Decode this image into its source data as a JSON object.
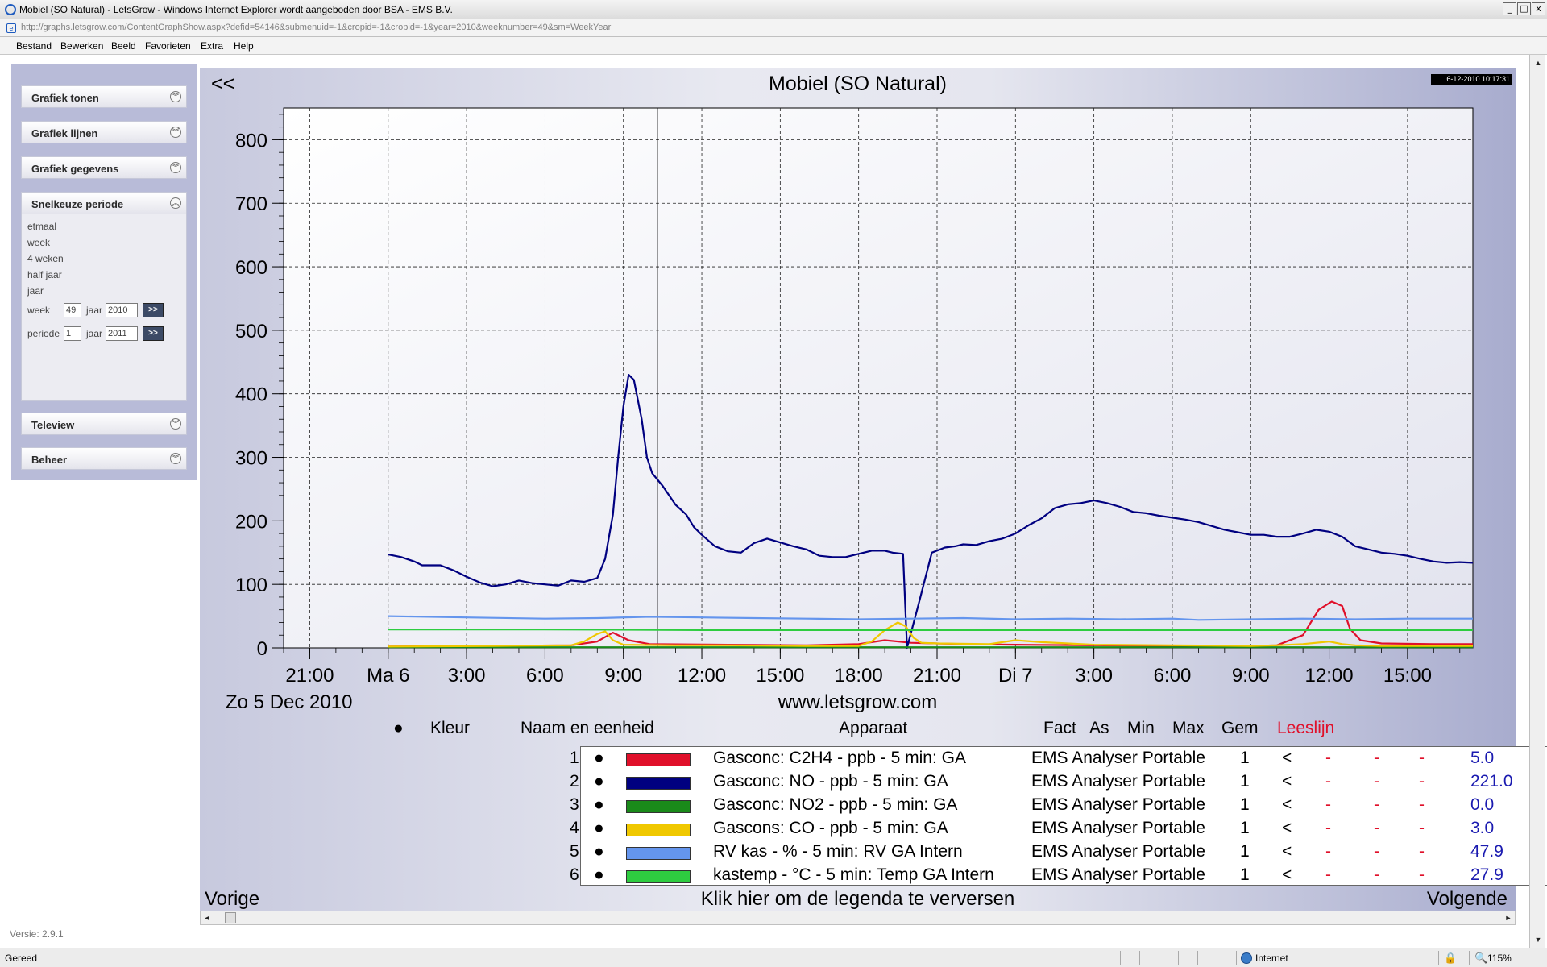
{
  "window": {
    "title": "Mobiel (SO Natural) - LetsGrow - Windows Internet Explorer wordt aangeboden door BSA - EMS B.V.",
    "url": "http://graphs.letsgrow.com/ContentGraphShow.aspx?defid=54146&submenuid=-1&cropid=-1&cropid=-1&year=2010&weeknumber=49&sm=WeekYear",
    "minimize": "_",
    "maximize": "□",
    "close": "x"
  },
  "menu": [
    "Bestand",
    "Bewerken",
    "Beeld",
    "Favorieten",
    "Extra",
    "Help"
  ],
  "sidebar": {
    "panels": [
      {
        "label": "Grafiek tonen"
      },
      {
        "label": "Grafiek lijnen"
      },
      {
        "label": "Grafiek gegevens"
      },
      {
        "label": "Snelkeuze periode"
      },
      {
        "label": "Teleview"
      },
      {
        "label": "Beheer"
      }
    ],
    "snelkeuze": {
      "links": [
        "etmaal",
        "week",
        "4 weken",
        "half jaar",
        "jaar"
      ],
      "week_label": "week",
      "week_value": "49",
      "jaar_label": "jaar",
      "jaar_value": "2010",
      "periode_label": "periode",
      "periode_value": "1",
      "jaar2_value": "2011",
      "go_label": ">>"
    },
    "version": "Versie: 2.9.1"
  },
  "chart_header": {
    "title": "Mobiel (SO Natural)",
    "back": "<<",
    "timestamp": "6-12-2010 10:17:31",
    "start_date": "Zo  5  Dec 2010",
    "website": "www.letsgrow.com"
  },
  "chart_data": {
    "type": "line",
    "title": "Mobiel (SO Natural)",
    "ylim": [
      0,
      850
    ],
    "yticks": [
      0,
      100,
      200,
      300,
      400,
      500,
      600,
      700,
      800
    ],
    "x_unit": "hours from Sun 5 Dec 2010 18:00",
    "xlim": [
      0,
      45.5
    ],
    "xticks": [
      {
        "x": 1,
        "label": "21:00"
      },
      {
        "x": 4,
        "label": "Ma  6"
      },
      {
        "x": 7,
        "label": "3:00"
      },
      {
        "x": 10,
        "label": "6:00"
      },
      {
        "x": 13,
        "label": "9:00"
      },
      {
        "x": 16,
        "label": "12:00"
      },
      {
        "x": 19,
        "label": "15:00"
      },
      {
        "x": 22,
        "label": "18:00"
      },
      {
        "x": 25,
        "label": "21:00"
      },
      {
        "x": 28,
        "label": "Di  7"
      },
      {
        "x": 31,
        "label": "3:00"
      },
      {
        "x": 34,
        "label": "6:00"
      },
      {
        "x": 37,
        "label": "9:00"
      },
      {
        "x": 40,
        "label": "12:00"
      },
      {
        "x": 43,
        "label": "15:00"
      }
    ],
    "read_line_x": 14.3,
    "grid": true,
    "series": [
      {
        "name": "Gasconc: C2H4 - ppb - 5 min: GA",
        "color": "#e0102a",
        "points": [
          [
            4,
            2
          ],
          [
            8,
            3
          ],
          [
            11,
            4
          ],
          [
            12,
            10
          ],
          [
            12.6,
            24
          ],
          [
            13.2,
            12
          ],
          [
            14,
            6
          ],
          [
            17,
            5
          ],
          [
            20,
            4
          ],
          [
            22,
            6
          ],
          [
            23,
            12
          ],
          [
            24,
            8
          ],
          [
            26,
            6
          ],
          [
            28,
            5
          ],
          [
            31,
            4
          ],
          [
            34,
            3
          ],
          [
            37,
            3
          ],
          [
            38,
            4
          ],
          [
            39,
            20
          ],
          [
            39.6,
            60
          ],
          [
            40.1,
            73
          ],
          [
            40.5,
            66
          ],
          [
            40.8,
            30
          ],
          [
            41.2,
            12
          ],
          [
            42,
            7
          ],
          [
            44,
            6
          ],
          [
            45.5,
            6
          ]
        ]
      },
      {
        "name": "Gasconc: NO - ppb - 5 min: GA",
        "color": "#000080",
        "points": [
          [
            4,
            147
          ],
          [
            4.5,
            143
          ],
          [
            5,
            136
          ],
          [
            5.3,
            130
          ],
          [
            6,
            130
          ],
          [
            6.5,
            122
          ],
          [
            7,
            112
          ],
          [
            7.5,
            103
          ],
          [
            8,
            97
          ],
          [
            8.5,
            100
          ],
          [
            9,
            106
          ],
          [
            9.5,
            102
          ],
          [
            10,
            100
          ],
          [
            10.5,
            98
          ],
          [
            11,
            106
          ],
          [
            11.5,
            104
          ],
          [
            12,
            110
          ],
          [
            12.3,
            140
          ],
          [
            12.6,
            210
          ],
          [
            12.8,
            300
          ],
          [
            13,
            380
          ],
          [
            13.2,
            430
          ],
          [
            13.4,
            422
          ],
          [
            13.7,
            360
          ],
          [
            13.9,
            300
          ],
          [
            14.1,
            275
          ],
          [
            14.5,
            255
          ],
          [
            15,
            225
          ],
          [
            15.4,
            210
          ],
          [
            15.7,
            190
          ],
          [
            16,
            178
          ],
          [
            16.5,
            160
          ],
          [
            17,
            152
          ],
          [
            17.5,
            150
          ],
          [
            18,
            165
          ],
          [
            18.5,
            172
          ],
          [
            19,
            166
          ],
          [
            19.5,
            160
          ],
          [
            20,
            155
          ],
          [
            20.5,
            145
          ],
          [
            21,
            143
          ],
          [
            21.5,
            143
          ],
          [
            22,
            148
          ],
          [
            22.5,
            153
          ],
          [
            23,
            153
          ],
          [
            23.3,
            150
          ],
          [
            23.7,
            148
          ],
          [
            23.85,
            0
          ],
          [
            24.3,
            70
          ],
          [
            24.8,
            150
          ],
          [
            25.3,
            158
          ],
          [
            25.7,
            160
          ],
          [
            26,
            163
          ],
          [
            26.5,
            162
          ],
          [
            27,
            168
          ],
          [
            27.5,
            172
          ],
          [
            28,
            180
          ],
          [
            28.5,
            193
          ],
          [
            29,
            204
          ],
          [
            29.5,
            220
          ],
          [
            30,
            226
          ],
          [
            30.5,
            228
          ],
          [
            31,
            232
          ],
          [
            31.5,
            228
          ],
          [
            32,
            222
          ],
          [
            32.5,
            214
          ],
          [
            33,
            212
          ],
          [
            33.5,
            208
          ],
          [
            34,
            205
          ],
          [
            34.5,
            202
          ],
          [
            35,
            198
          ],
          [
            35.5,
            192
          ],
          [
            36,
            186
          ],
          [
            36.5,
            182
          ],
          [
            37,
            178
          ],
          [
            37.5,
            178
          ],
          [
            38,
            175
          ],
          [
            38.5,
            175
          ],
          [
            39,
            180
          ],
          [
            39.5,
            186
          ],
          [
            40,
            183
          ],
          [
            40.5,
            175
          ],
          [
            41,
            160
          ],
          [
            41.5,
            155
          ],
          [
            42,
            150
          ],
          [
            42.5,
            148
          ],
          [
            43,
            145
          ],
          [
            43.5,
            140
          ],
          [
            44,
            136
          ],
          [
            44.5,
            134
          ],
          [
            45,
            135
          ],
          [
            45.5,
            134
          ]
        ]
      },
      {
        "name": "Gasconc: NO2 - ppb - 5 min: GA",
        "color": "#1a8a1a",
        "points": [
          [
            4,
            1
          ],
          [
            45.5,
            1
          ]
        ]
      },
      {
        "name": "Gascons: CO - ppb - 5 min: GA",
        "color": "#f0c800",
        "points": [
          [
            4,
            2
          ],
          [
            8,
            3
          ],
          [
            11,
            4
          ],
          [
            11.5,
            10
          ],
          [
            12,
            22
          ],
          [
            12.3,
            26
          ],
          [
            12.6,
            12
          ],
          [
            13,
            5
          ],
          [
            15,
            4
          ],
          [
            17,
            4
          ],
          [
            20,
            3
          ],
          [
            22,
            3
          ],
          [
            22.5,
            10
          ],
          [
            23,
            28
          ],
          [
            23.5,
            40
          ],
          [
            23.8,
            34
          ],
          [
            24.1,
            16
          ],
          [
            24.4,
            8
          ],
          [
            25,
            7
          ],
          [
            27,
            6
          ],
          [
            28,
            12
          ],
          [
            29,
            9
          ],
          [
            30,
            7
          ],
          [
            31,
            5
          ],
          [
            34,
            4
          ],
          [
            37,
            3
          ],
          [
            38,
            4
          ],
          [
            39,
            6
          ],
          [
            40,
            10
          ],
          [
            40.5,
            6
          ],
          [
            41,
            4
          ],
          [
            42,
            3
          ],
          [
            45.5,
            3
          ]
        ]
      },
      {
        "name": "RV kas - % - 5 min: RV GA Intern",
        "color": "#6495ed",
        "points": [
          [
            4,
            50
          ],
          [
            7,
            48
          ],
          [
            10,
            46
          ],
          [
            12,
            47
          ],
          [
            14,
            49
          ],
          [
            16,
            48
          ],
          [
            18,
            47
          ],
          [
            20,
            46
          ],
          [
            22,
            45
          ],
          [
            24,
            46
          ],
          [
            26,
            47
          ],
          [
            28,
            45
          ],
          [
            30,
            46
          ],
          [
            32,
            45
          ],
          [
            34,
            46
          ],
          [
            35,
            44
          ],
          [
            37,
            45
          ],
          [
            39,
            46
          ],
          [
            41,
            45
          ],
          [
            43,
            46
          ],
          [
            45.5,
            46
          ]
        ]
      },
      {
        "name": "kastemp - °C - 5 min: Temp GA Intern",
        "color": "#2ecc40",
        "points": [
          [
            4,
            29
          ],
          [
            10,
            29
          ],
          [
            16,
            28
          ],
          [
            22,
            28
          ],
          [
            28,
            28
          ],
          [
            34,
            28
          ],
          [
            40,
            28
          ],
          [
            45.5,
            28
          ]
        ]
      }
    ]
  },
  "legend": {
    "headers": {
      "bullet": "●",
      "kleur": "Kleur",
      "naam": "Naam en eenheid",
      "apparaat": "Apparaat",
      "fact": "Fact",
      "as": "As",
      "min": "Min",
      "max": "Max",
      "gem": "Gem",
      "leeslijn": "Leeslijn"
    },
    "rows": [
      {
        "num": "1",
        "bullet": "●",
        "color": "#e0102a",
        "name": "Gasconc: C2H4 - ppb - 5 min: GA",
        "apparaat": "EMS Analyser Portable",
        "fact": "1",
        "as": "<",
        "min": "-",
        "max": "-",
        "gem": "-",
        "leeslijn": "5.0"
      },
      {
        "num": "2",
        "bullet": "●",
        "color": "#000080",
        "name": "Gasconc: NO - ppb - 5 min: GA",
        "apparaat": "EMS Analyser Portable",
        "fact": "1",
        "as": "<",
        "min": "-",
        "max": "-",
        "gem": "-",
        "leeslijn": "221.0"
      },
      {
        "num": "3",
        "bullet": "●",
        "color": "#1a8a1a",
        "name": "Gasconc: NO2 - ppb - 5 min: GA",
        "apparaat": "EMS Analyser Portable",
        "fact": "1",
        "as": "<",
        "min": "-",
        "max": "-",
        "gem": "-",
        "leeslijn": "0.0"
      },
      {
        "num": "4",
        "bullet": "●",
        "color": "#f0c800",
        "name": "Gascons: CO - ppb - 5 min: GA",
        "apparaat": "EMS Analyser Portable",
        "fact": "1",
        "as": "<",
        "min": "-",
        "max": "-",
        "gem": "-",
        "leeslijn": "3.0"
      },
      {
        "num": "5",
        "bullet": "●",
        "color": "#6495ed",
        "name": "RV kas - % - 5 min: RV GA Intern",
        "apparaat": "EMS Analyser Portable",
        "fact": "1",
        "as": "<",
        "min": "-",
        "max": "-",
        "gem": "-",
        "leeslijn": "47.9"
      },
      {
        "num": "6",
        "bullet": "●",
        "color": "#2ecc40",
        "name": "kastemp - °C - 5 min: Temp GA Intern",
        "apparaat": "EMS Analyser Portable",
        "fact": "1",
        "as": "<",
        "min": "-",
        "max": "-",
        "gem": "-",
        "leeslijn": "27.9"
      }
    ]
  },
  "footer_nav": {
    "vorige": "Vorige",
    "refresh": "Klik hier om de legenda te verversen",
    "volgende": "Volgende"
  },
  "scroll": {
    "left": "◄",
    "right": "►",
    "up": "▲",
    "down": "▼"
  },
  "statusbar": {
    "status": "Gereed",
    "zone": "Internet",
    "zoom": "115%",
    "lock_icon": "🔒",
    "zoom_icon": "🔍"
  }
}
